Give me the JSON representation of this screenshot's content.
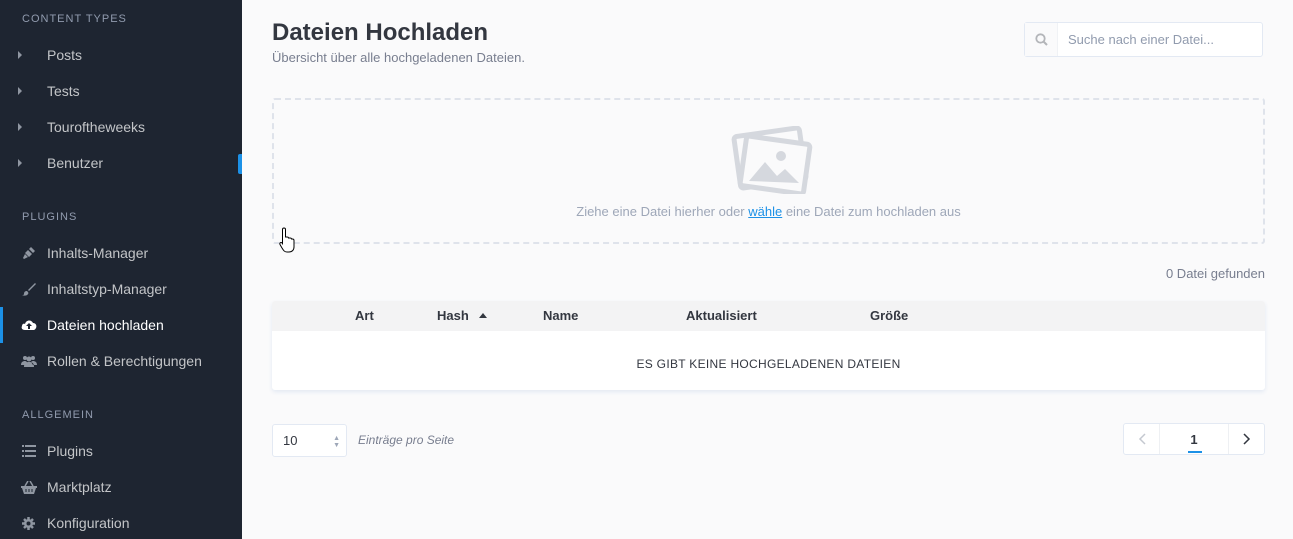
{
  "sidebar": {
    "sections": [
      {
        "title": "Content Types",
        "items": [
          {
            "label": "Posts",
            "icon": "caret-right-icon"
          },
          {
            "label": "Tests",
            "icon": "caret-right-icon"
          },
          {
            "label": "Touroftheweeks",
            "icon": "caret-right-icon"
          },
          {
            "label": "Benutzer",
            "icon": "caret-right-icon"
          }
        ]
      },
      {
        "title": "Plugins",
        "items": [
          {
            "label": "Inhalts-Manager",
            "icon": "plug-icon"
          },
          {
            "label": "Inhaltstyp-Manager",
            "icon": "paint-brush-icon"
          },
          {
            "label": "Dateien hochladen",
            "icon": "cloud-upload-icon",
            "active": true
          },
          {
            "label": "Rollen & Berechtigungen",
            "icon": "users-icon"
          }
        ]
      },
      {
        "title": "Allgemein",
        "items": [
          {
            "label": "Plugins",
            "icon": "list-icon"
          },
          {
            "label": "Marktplatz",
            "icon": "shopping-basket-icon"
          },
          {
            "label": "Konfiguration",
            "icon": "gear-icon"
          }
        ]
      }
    ]
  },
  "header": {
    "title": "Dateien Hochladen",
    "subtitle": "Übersicht über alle hochgeladenen Dateien."
  },
  "search": {
    "placeholder": "Suche nach einer Datei..."
  },
  "dropzone": {
    "text_before": "Ziehe eine Datei hierher oder ",
    "link": "wähle",
    "text_after": " eine Datei zum hochladen aus"
  },
  "results_count": "0 Datei gefunden",
  "table": {
    "columns": [
      "Art",
      "Hash",
      "Name",
      "Aktualisiert",
      "Größe"
    ],
    "sorted_column": "Hash",
    "empty_message": "ES GIBT KEINE HOCHGELADENEN DATEIEN"
  },
  "pagination": {
    "per_page": "10",
    "per_page_label": "Einträge pro Seite",
    "current_page": "1"
  },
  "colors": {
    "accent": "#1c91e7",
    "sidebar_bg": "#1e2531"
  }
}
